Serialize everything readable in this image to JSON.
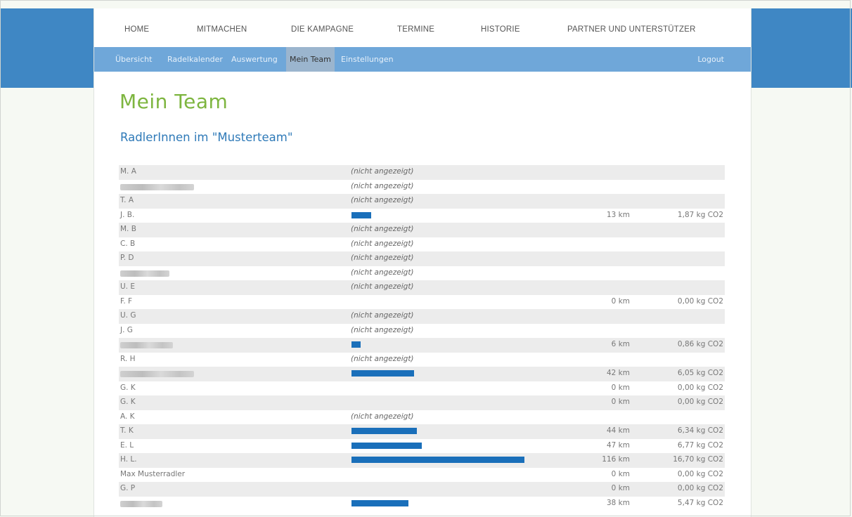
{
  "top_nav": [
    "HOME",
    "MITMACHEN",
    "DIE KAMPAGNE",
    "TERMINE",
    "HISTORIE",
    "PARTNER UND UNTERSTÜTZER"
  ],
  "sub_nav": [
    "Übersicht",
    "Radelkalender",
    "Auswertung",
    "Mein Team",
    "Einstellungen"
  ],
  "sub_nav_active": "Mein Team",
  "logout_label": "Logout",
  "page_title": "Mein Team",
  "section_title": "RadlerInnen im \"Musterteam\"",
  "colors": {
    "accent_green": "#7db53f",
    "heading_blue": "#2f7ab8",
    "bar_blue": "#1a6fba",
    "subnav_bg": "#6fa7d9",
    "band_blue": "#3f87c4"
  },
  "max_km": 116,
  "rows": [
    {
      "name": "M. A",
      "note": "(nicht angezeigt)"
    },
    {
      "blurred": true,
      "note": "(nicht angezeigt)"
    },
    {
      "name": "T. A",
      "note": "(nicht angezeigt)"
    },
    {
      "name": "J. B.",
      "km_value": 13,
      "km": "13 km",
      "co2": "1,87 kg CO2"
    },
    {
      "name": "M. B",
      "note": "(nicht angezeigt)"
    },
    {
      "name": "C. B",
      "note": "(nicht angezeigt)"
    },
    {
      "name": "P. D",
      "note": "(nicht angezeigt)"
    },
    {
      "blurred": true,
      "note": "(nicht angezeigt)"
    },
    {
      "name": "U. E",
      "note": "(nicht angezeigt)"
    },
    {
      "name": "F. F",
      "km_value": 0,
      "km": "0 km",
      "co2": "0,00 kg CO2"
    },
    {
      "name": "U. G",
      "note": "(nicht angezeigt)"
    },
    {
      "name": "J. G",
      "note": "(nicht angezeigt)"
    },
    {
      "blurred": true,
      "km_value": 6,
      "km": "6 km",
      "co2": "0,86 kg CO2"
    },
    {
      "name": "R. H",
      "note": "(nicht angezeigt)"
    },
    {
      "blurred": true,
      "km_value": 42,
      "km": "42 km",
      "co2": "6,05 kg CO2"
    },
    {
      "name": "G. K",
      "km_value": 0,
      "km": "0 km",
      "co2": "0,00 kg CO2"
    },
    {
      "name": "G. K",
      "km_value": 0,
      "km": "0 km",
      "co2": "0,00 kg CO2"
    },
    {
      "name": "A. K",
      "note": "(nicht angezeigt)"
    },
    {
      "name": "T. K",
      "km_value": 44,
      "km": "44 km",
      "co2": "6,34 kg CO2"
    },
    {
      "name": "E. L",
      "km_value": 47,
      "km": "47 km",
      "co2": "6,77 kg CO2"
    },
    {
      "name": "H. L.",
      "km_value": 116,
      "km": "116 km",
      "co2": "16,70 kg CO2"
    },
    {
      "name": "Max Musterradler",
      "km_value": 0,
      "km": "0 km",
      "co2": "0,00 kg CO2"
    },
    {
      "name": "G. P",
      "km_value": 0,
      "km": "0 km",
      "co2": "0,00 kg CO2"
    },
    {
      "blurred": true,
      "km_value": 38,
      "km": "38 km",
      "co2": "5,47 kg CO2"
    }
  ]
}
